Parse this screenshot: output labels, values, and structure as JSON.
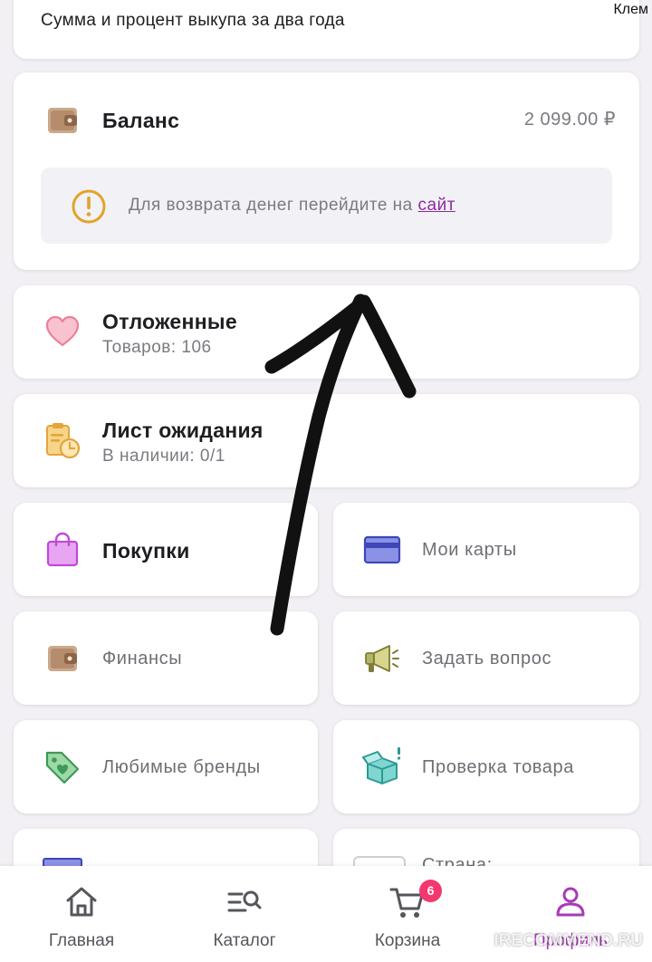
{
  "top_card": {
    "text": "Сумма и процент выкупа за два года"
  },
  "corner_text": "Клем",
  "balance": {
    "title": "Баланс",
    "amount": "2 099.00 ₽",
    "notice_text": "Для возврата денег перейдите на ",
    "notice_link": "сайт"
  },
  "favorites": {
    "title": "Отложенные",
    "subtitle": "Товаров: 106"
  },
  "waitlist": {
    "title": "Лист ожидания",
    "subtitle": "В наличии: 0/1"
  },
  "grid": {
    "purchases": "Покупки",
    "my_cards": "Мои карты",
    "finances": "Финансы",
    "ask_question": "Задать вопрос",
    "favorite_brands": "Любимые бренды",
    "product_check": "Проверка товара",
    "country": "Страна:"
  },
  "bottom_nav": {
    "home": "Главная",
    "catalog": "Каталог",
    "cart": "Корзина",
    "cart_badge": "6",
    "profile": "Профиль"
  },
  "watermark": "IRECOMMEND.RU",
  "colors": {
    "accent": "#a73bb5",
    "link": "#8d2b9e",
    "badge": "#f2386e",
    "warning": "#e3a229"
  },
  "icons": {
    "balance": "wallet-icon",
    "notice": "exclamation-circle-icon",
    "favorites": "heart-icon",
    "waitlist": "clipboard-clock-icon",
    "purchases": "shopping-bag-icon",
    "my_cards": "credit-card-icon",
    "finances": "wallet-icon",
    "ask_question": "megaphone-icon",
    "favorite_brands": "price-tag-icon",
    "product_check": "open-box-icon",
    "home": "home-icon",
    "catalog": "catalog-search-icon",
    "cart": "cart-icon",
    "profile": "user-icon"
  }
}
